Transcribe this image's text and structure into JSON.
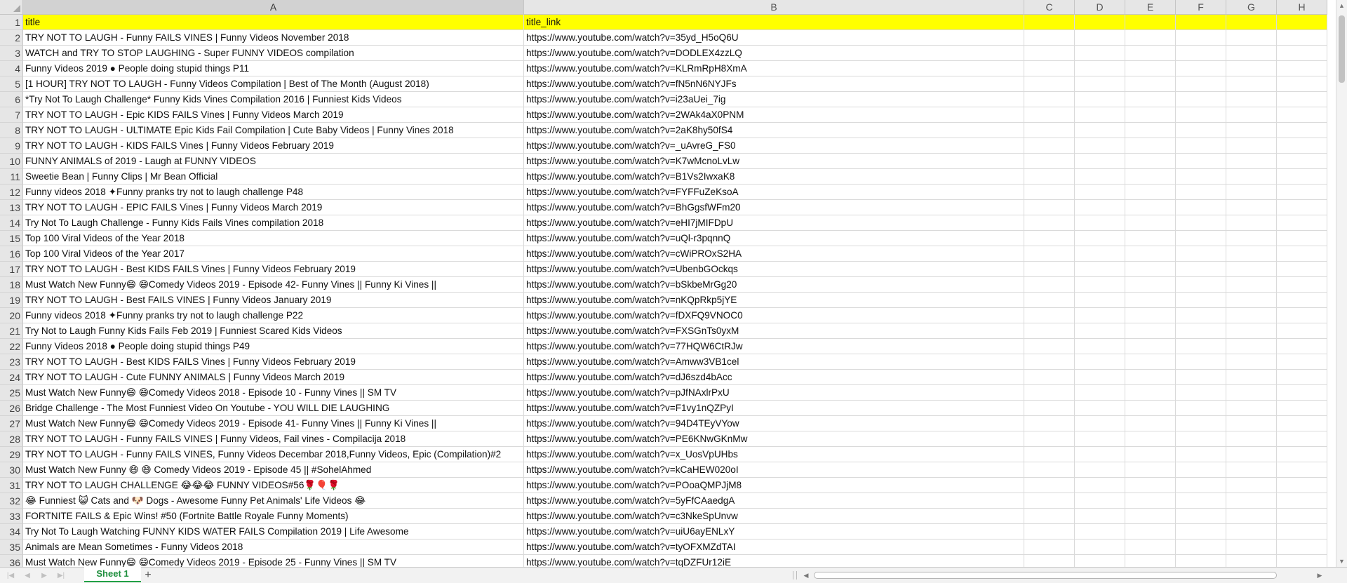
{
  "columns": [
    "A",
    "B",
    "C",
    "D",
    "E",
    "F",
    "G",
    "H"
  ],
  "selected_column": "A",
  "rows": [
    {
      "num": "1",
      "a": "title",
      "b": "title_link"
    },
    {
      "num": "2",
      "a": "TRY NOT TO LAUGH - Funny FAILS VINES | Funny Videos November 2018",
      "b": "https://www.youtube.com/watch?v=35yd_H5oQ6U"
    },
    {
      "num": "3",
      "a": "WATCH and TRY TO STOP LAUGHING - Super FUNNY VIDEOS compilation",
      "b": "https://www.youtube.com/watch?v=DODLEX4zzLQ"
    },
    {
      "num": "4",
      "a": "Funny Videos 2019 ● People doing stupid things P11",
      "b": "https://www.youtube.com/watch?v=KLRmRpH8XmA"
    },
    {
      "num": "5",
      "a": "[1 HOUR] TRY NOT TO LAUGH - Funny Videos Compilation | Best of The Month (August 2018)",
      "b": "https://www.youtube.com/watch?v=fN5nN6NYJFs"
    },
    {
      "num": "6",
      "a": "*Try Not To Laugh Challenge* Funny Kids Vines Compilation 2016 | Funniest Kids Videos",
      "b": "https://www.youtube.com/watch?v=i23aUei_7ig"
    },
    {
      "num": "7",
      "a": "TRY NOT TO LAUGH - Epic KIDS FAILS Vines | Funny Videos March 2019",
      "b": "https://www.youtube.com/watch?v=2WAk4aX0PNM"
    },
    {
      "num": "8",
      "a": "TRY NOT TO LAUGH - ULTIMATE Epic Kids Fail Compilation | Cute Baby Videos | Funny Vines 2018",
      "b": "https://www.youtube.com/watch?v=2aK8hy50fS4"
    },
    {
      "num": "9",
      "a": "TRY NOT TO LAUGH - KIDS FAILS Vines | Funny Videos February 2019",
      "b": "https://www.youtube.com/watch?v=_uAvreG_FS0"
    },
    {
      "num": "10",
      "a": "FUNNY ANIMALS of 2019 - Laugh at FUNNY VIDEOS",
      "b": "https://www.youtube.com/watch?v=K7wMcnoLvLw"
    },
    {
      "num": "11",
      "a": "Sweetie Bean | Funny Clips | Mr Bean Official",
      "b": "https://www.youtube.com/watch?v=B1Vs2IwxaK8"
    },
    {
      "num": "12",
      "a": "Funny videos 2018 ✦Funny pranks try not to laugh challenge P48",
      "b": "https://www.youtube.com/watch?v=FYFFuZeKsoA"
    },
    {
      "num": "13",
      "a": "TRY NOT TO LAUGH - EPIC FAILS Vines | Funny Videos March 2019",
      "b": "https://www.youtube.com/watch?v=BhGgsfWFm20"
    },
    {
      "num": "14",
      "a": "Try Not To Laugh Challenge - Funny Kids Fails Vines compilation 2018",
      "b": "https://www.youtube.com/watch?v=eHI7jMIFDpU"
    },
    {
      "num": "15",
      "a": "Top 100 Viral Videos of the Year 2018",
      "b": "https://www.youtube.com/watch?v=uQl-r3pqnnQ"
    },
    {
      "num": "16",
      "a": "Top 100 Viral Videos of the Year 2017",
      "b": "https://www.youtube.com/watch?v=cWiPROxS2HA"
    },
    {
      "num": "17",
      "a": "TRY NOT TO LAUGH - Best KIDS FAILS Vines | Funny Videos February 2019",
      "b": "https://www.youtube.com/watch?v=UbenbGOckqs"
    },
    {
      "num": "18",
      "a": "Must Watch New Funny😄 😄Comedy Videos 2019 - Episode 42- Funny Vines || Funny Ki Vines ||",
      "b": "https://www.youtube.com/watch?v=bSkbeMrGg20"
    },
    {
      "num": "19",
      "a": "TRY NOT TO LAUGH - Best FAILS VINES | Funny Videos January 2019",
      "b": "https://www.youtube.com/watch?v=nKQpRkp5jYE"
    },
    {
      "num": "20",
      "a": "Funny videos 2018 ✦Funny pranks try not to laugh challenge P22",
      "b": "https://www.youtube.com/watch?v=fDXFQ9VNOC0"
    },
    {
      "num": "21",
      "a": "Try Not to Laugh Funny Kids Fails Feb 2019 | Funniest Scared Kids Videos",
      "b": "https://www.youtube.com/watch?v=FXSGnTs0yxM"
    },
    {
      "num": "22",
      "a": "Funny Videos 2018 ● People doing stupid things P49",
      "b": "https://www.youtube.com/watch?v=77HQW6CtRJw"
    },
    {
      "num": "23",
      "a": "TRY NOT TO LAUGH - Best KIDS FAILS Vines | Funny Videos February 2019",
      "b": "https://www.youtube.com/watch?v=Amww3VB1cel"
    },
    {
      "num": "24",
      "a": "TRY NOT TO LAUGH - Cute FUNNY ANIMALS | Funny Videos March 2019",
      "b": "https://www.youtube.com/watch?v=dJ6szd4bAcc"
    },
    {
      "num": "25",
      "a": "Must Watch New Funny😄 😄Comedy Videos 2018 - Episode 10 - Funny Vines || SM TV",
      "b": "https://www.youtube.com/watch?v=pJfNAxlrPxU"
    },
    {
      "num": "26",
      "a": "Bridge Challenge - The Most Funniest Video On Youtube - YOU WILL DIE LAUGHING",
      "b": "https://www.youtube.com/watch?v=F1vy1nQZPyI"
    },
    {
      "num": "27",
      "a": "Must Watch New Funny😄 😄Comedy Videos 2019 - Episode 41- Funny Vines || Funny Ki Vines ||",
      "b": "https://www.youtube.com/watch?v=94D4TEyVYow"
    },
    {
      "num": "28",
      "a": "TRY NOT TO LAUGH - Funny FAILS VINES | Funny Videos, Fail vines - Compilacija 2018",
      "b": "https://www.youtube.com/watch?v=PE6KNwGKnMw"
    },
    {
      "num": "29",
      "a": "TRY NOT TO LAUGH - Funny FAILS VINES, Funny Videos Decembar 2018,Funny Videos, Epic (Compilation)#2",
      "b": "https://www.youtube.com/watch?v=x_UosVpUHbs"
    },
    {
      "num": "30",
      "a": "Must Watch New Funny 😄 😄 Comedy Videos 2019 - Episode 45 || #SohelAhmed",
      "b": "https://www.youtube.com/watch?v=kCaHEW020oI"
    },
    {
      "num": "31",
      "a": "TRY NOT TO LAUGH CHALLENGE 😂😂😂 FUNNY VIDEOS#56🌹🎈🌹",
      "b": "https://www.youtube.com/watch?v=POoaQMPJjM8"
    },
    {
      "num": "32",
      "a": "😂 Funniest 😺 Cats and 🐶 Dogs - Awesome Funny Pet Animals' Life Videos 😂",
      "b": "https://www.youtube.com/watch?v=5yFfCAaedgA"
    },
    {
      "num": "33",
      "a": "FORTNITE FAILS & Epic Wins! #50 (Fortnite Battle Royale Funny Moments)",
      "b": "https://www.youtube.com/watch?v=c3NkeSpUnvw"
    },
    {
      "num": "34",
      "a": "Try Not To Laugh Watching FUNNY KIDS WATER FAILS Compilation 2019 | Life Awesome",
      "b": "https://www.youtube.com/watch?v=uiU6ayENLxY"
    },
    {
      "num": "35",
      "a": "Animals are Mean Sometimes -  Funny Videos 2018",
      "b": "https://www.youtube.com/watch?v=tyOFXMZdTAI"
    },
    {
      "num": "36",
      "a": "Must Watch New Funny😄 😄Comedy Videos 2019 - Episode 25 - Funny Vines || SM TV",
      "b": "https://www.youtube.com/watch?v=tqDZFUr12iE"
    }
  ],
  "sheet_tab": {
    "label": "Sheet 1"
  },
  "add_sheet": {
    "label": "+"
  },
  "colors": {
    "header_fill": "#ffff00",
    "tab_accent": "#22a046"
  }
}
